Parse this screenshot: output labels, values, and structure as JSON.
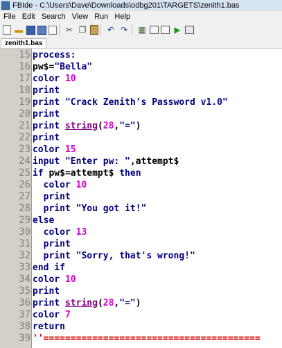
{
  "window": {
    "title": "FBIde - C:\\Users\\Dave\\Downloads\\odbg201\\TARGETS\\zenith1.bas"
  },
  "menu": [
    "File",
    "Edit",
    "Search",
    "View",
    "Run",
    "Help"
  ],
  "toolbar": {
    "icons": [
      "new-file-icon",
      "open-icon",
      "save-icon",
      "save-all-icon",
      "close-file-icon",
      "cut-icon",
      "copy-icon",
      "paste-icon",
      "undo-icon",
      "redo-icon",
      "compile-icon",
      "compile-run-icon",
      "new-window-icon",
      "run-icon",
      "quick-run-icon"
    ]
  },
  "tab": {
    "label": "zenith1.bas"
  },
  "editor": {
    "colors": {
      "keyword": "#000080",
      "number": "#d300d3",
      "string": "#000080",
      "function": "#800080",
      "comment": "#d00000",
      "gutter": "#d4d0c8"
    },
    "lines": [
      {
        "num": "15",
        "indent": "",
        "tokens": [
          {
            "t": "process:",
            "c": "kw"
          }
        ]
      },
      {
        "num": "16",
        "indent": "",
        "tokens": [
          {
            "t": "pw$=",
            "c": "var"
          },
          {
            "t": "\"Bella\"",
            "c": "str"
          }
        ]
      },
      {
        "num": "17",
        "indent": "",
        "tokens": [
          {
            "t": "color ",
            "c": "kw"
          },
          {
            "t": "10",
            "c": "num"
          }
        ]
      },
      {
        "num": "18",
        "indent": "",
        "tokens": [
          {
            "t": "print",
            "c": "kw"
          }
        ]
      },
      {
        "num": "19",
        "indent": "",
        "tokens": [
          {
            "t": "print ",
            "c": "kw"
          },
          {
            "t": "\"Crack Zenith's Password v1.0\"",
            "c": "str"
          }
        ]
      },
      {
        "num": "20",
        "indent": "",
        "tokens": [
          {
            "t": "print",
            "c": "kw"
          }
        ]
      },
      {
        "num": "21",
        "indent": "",
        "tokens": [
          {
            "t": "print ",
            "c": "kw"
          },
          {
            "t": "string",
            "c": "fn"
          },
          {
            "t": "(",
            "c": "var"
          },
          {
            "t": "28",
            "c": "num"
          },
          {
            "t": ",",
            "c": "var"
          },
          {
            "t": "\"=\"",
            "c": "str"
          },
          {
            "t": ")",
            "c": "var"
          }
        ]
      },
      {
        "num": "22",
        "indent": "",
        "tokens": [
          {
            "t": "print",
            "c": "kw"
          }
        ]
      },
      {
        "num": "23",
        "indent": "",
        "tokens": [
          {
            "t": "color ",
            "c": "kw"
          },
          {
            "t": "15",
            "c": "num"
          }
        ]
      },
      {
        "num": "24",
        "indent": "",
        "tokens": [
          {
            "t": "input ",
            "c": "kw"
          },
          {
            "t": "\"Enter pw: \"",
            "c": "str"
          },
          {
            "t": ",attempt$",
            "c": "var"
          }
        ]
      },
      {
        "num": "25",
        "indent": "",
        "tokens": [
          {
            "t": "if ",
            "c": "kw"
          },
          {
            "t": "pw$=attempt$ ",
            "c": "var"
          },
          {
            "t": "then",
            "c": "kw"
          }
        ]
      },
      {
        "num": "26",
        "indent": "  ",
        "tokens": [
          {
            "t": "color ",
            "c": "kw"
          },
          {
            "t": "10",
            "c": "num"
          }
        ]
      },
      {
        "num": "27",
        "indent": "  ",
        "tokens": [
          {
            "t": "print",
            "c": "kw"
          }
        ]
      },
      {
        "num": "28",
        "indent": "  ",
        "tokens": [
          {
            "t": "print ",
            "c": "kw"
          },
          {
            "t": "\"You got it!\"",
            "c": "str"
          }
        ]
      },
      {
        "num": "29",
        "indent": "",
        "tokens": [
          {
            "t": "else",
            "c": "kw"
          }
        ]
      },
      {
        "num": "30",
        "indent": "  ",
        "tokens": [
          {
            "t": "color ",
            "c": "kw"
          },
          {
            "t": "13",
            "c": "num"
          }
        ]
      },
      {
        "num": "31",
        "indent": "  ",
        "tokens": [
          {
            "t": "print",
            "c": "kw"
          }
        ]
      },
      {
        "num": "32",
        "indent": "  ",
        "tokens": [
          {
            "t": "print ",
            "c": "kw"
          },
          {
            "t": "\"Sorry, that's wrong!\"",
            "c": "str"
          }
        ]
      },
      {
        "num": "33",
        "indent": "",
        "tokens": [
          {
            "t": "end if",
            "c": "kw"
          }
        ]
      },
      {
        "num": "34",
        "indent": "",
        "tokens": [
          {
            "t": "color ",
            "c": "kw"
          },
          {
            "t": "10",
            "c": "num"
          }
        ]
      },
      {
        "num": "35",
        "indent": "",
        "tokens": [
          {
            "t": "print",
            "c": "kw"
          }
        ]
      },
      {
        "num": "36",
        "indent": "",
        "tokens": [
          {
            "t": "print ",
            "c": "kw"
          },
          {
            "t": "string",
            "c": "fn"
          },
          {
            "t": "(",
            "c": "var"
          },
          {
            "t": "28",
            "c": "num"
          },
          {
            "t": ",",
            "c": "var"
          },
          {
            "t": "\"=\"",
            "c": "str"
          },
          {
            "t": ")",
            "c": "var"
          }
        ]
      },
      {
        "num": "37",
        "indent": "",
        "tokens": [
          {
            "t": "color ",
            "c": "kw"
          },
          {
            "t": "7",
            "c": "num"
          }
        ]
      },
      {
        "num": "38",
        "indent": "",
        "tokens": [
          {
            "t": "return",
            "c": "kw"
          }
        ]
      },
      {
        "num": "39",
        "indent": "",
        "tokens": [
          {
            "t": "''========================================",
            "c": "cm"
          }
        ]
      }
    ]
  }
}
